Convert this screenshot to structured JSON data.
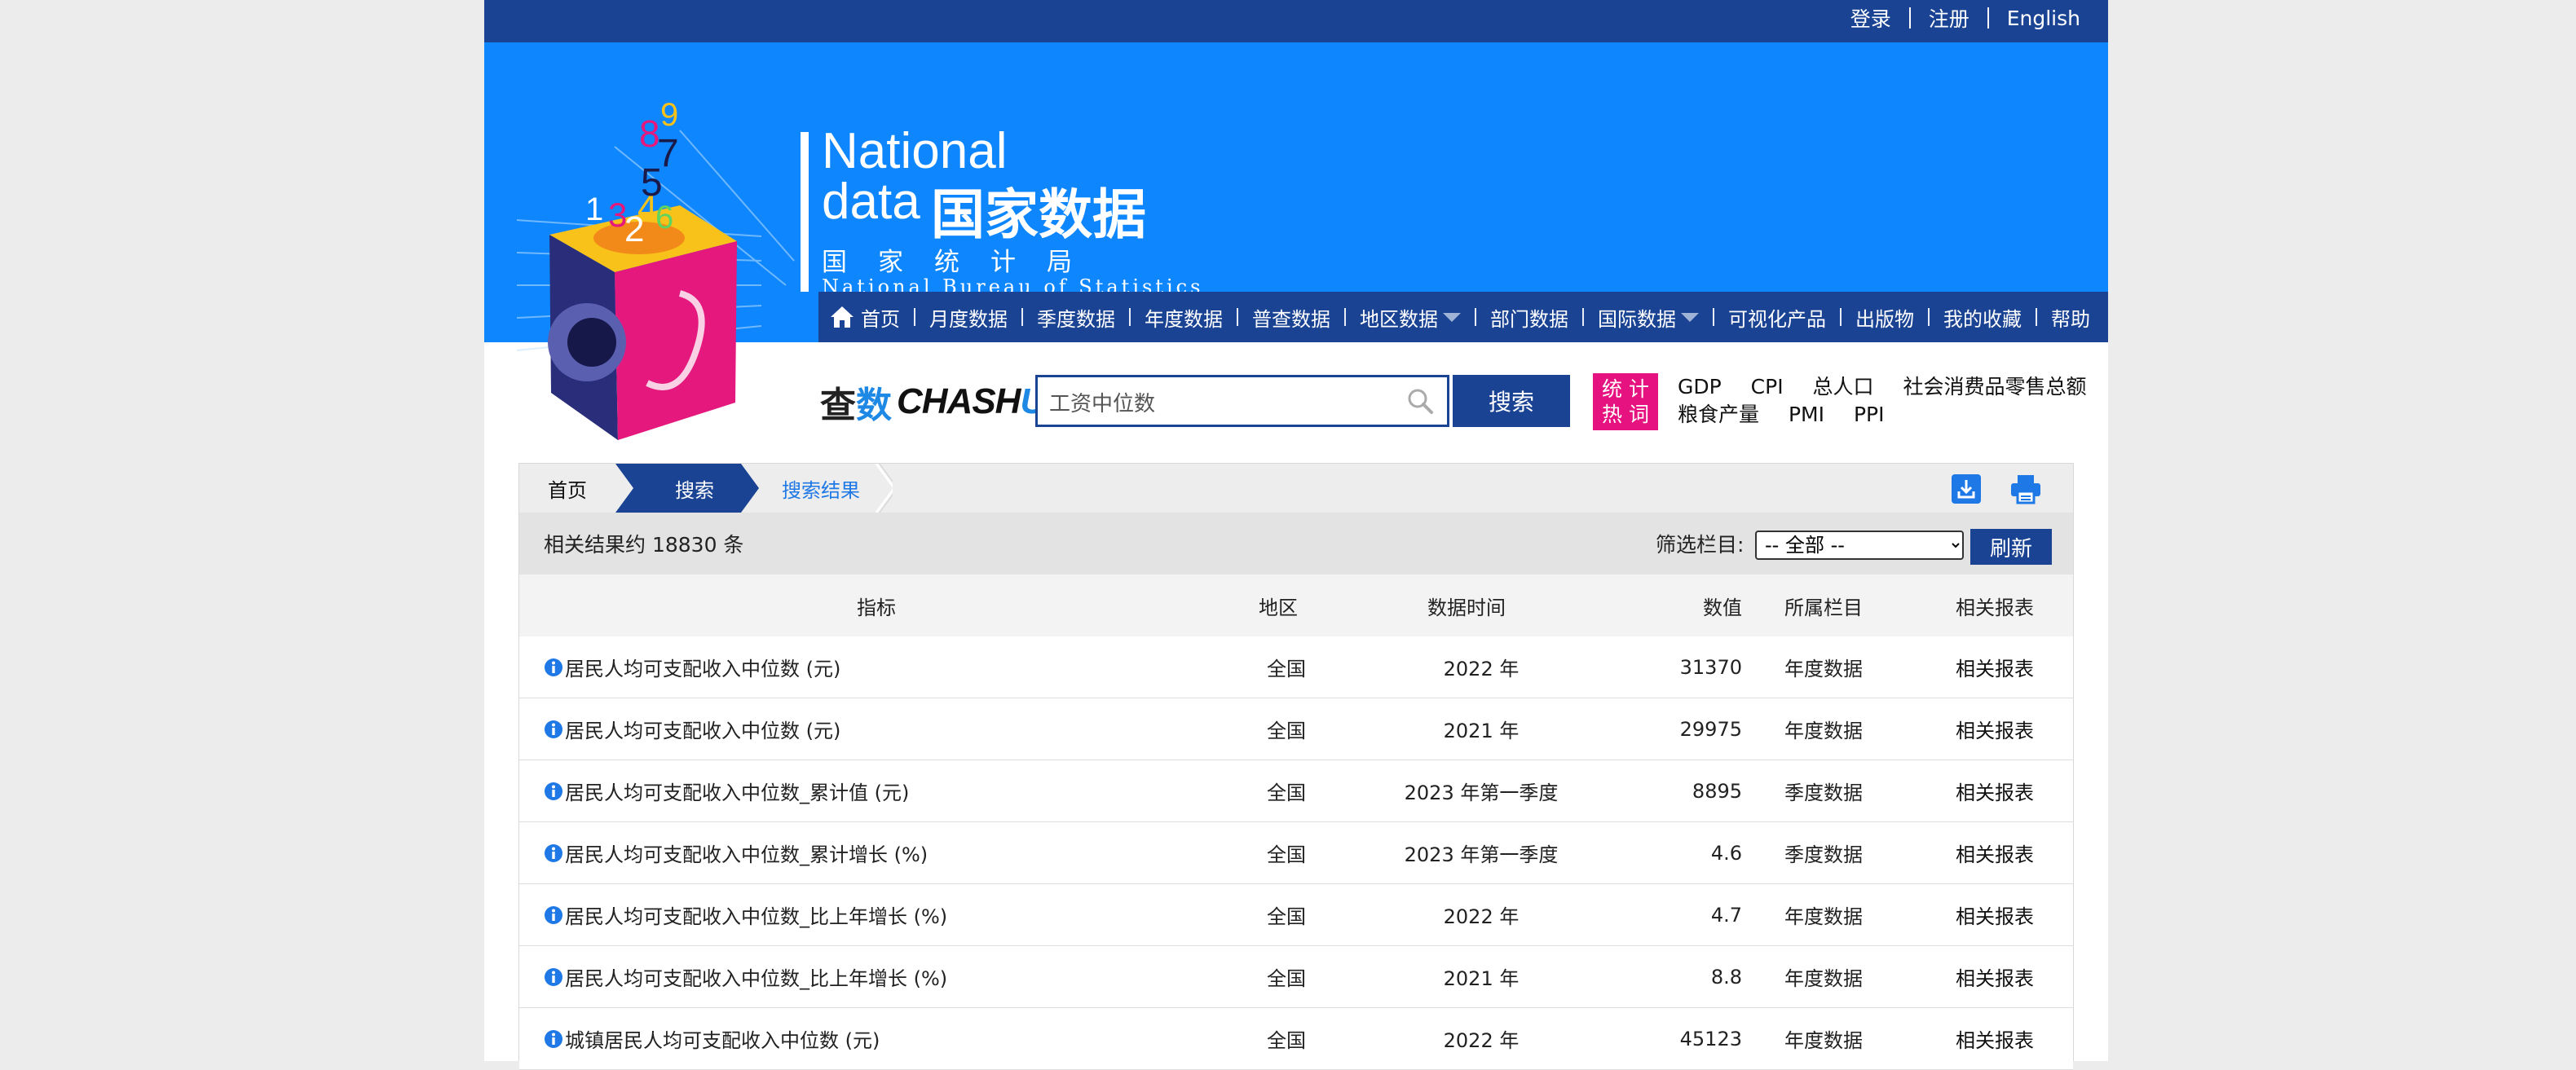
{
  "top_links": [
    "登录",
    "注册",
    "English"
  ],
  "brand": {
    "line1": "National",
    "line2_en": "data",
    "line2_cn": "国家数据",
    "bureau_cn": "国家统计局",
    "bureau_en": "National Bureau of Statistics"
  },
  "nav": [
    {
      "label": "首页",
      "icon": "home-icon"
    },
    {
      "label": "月度数据"
    },
    {
      "label": "季度数据"
    },
    {
      "label": "年度数据"
    },
    {
      "label": "普查数据"
    },
    {
      "label": "地区数据",
      "dropdown": true
    },
    {
      "label": "部门数据"
    },
    {
      "label": "国际数据",
      "dropdown": true
    },
    {
      "label": "可视化产品"
    },
    {
      "label": "出版物"
    },
    {
      "label": "我的收藏"
    },
    {
      "label": "帮助"
    }
  ],
  "search": {
    "logo_cn1": "查",
    "logo_cn2": "数",
    "logo_en_a": "CHASH",
    "logo_en_b": "U",
    "value": "工资中位数",
    "button_label": "搜索"
  },
  "hot": {
    "badge_line1": "统 计",
    "badge_line2": "热 词",
    "words_row1": [
      "GDP",
      "CPI",
      "总人口",
      "社会消费品零售总额"
    ],
    "words_row2": [
      "粮食产量",
      "PMI",
      "PPI"
    ]
  },
  "breadcrumb": {
    "home": "首页",
    "search": "搜索",
    "results": "搜索结果"
  },
  "results": {
    "count_text": "相关结果约 18830 条",
    "filter_label": "筛选栏目:",
    "filter_selected": "-- 全部 --",
    "refresh_label": "刷新"
  },
  "table": {
    "headers": {
      "indicator": "指标",
      "region": "地区",
      "time": "数据时间",
      "value": "数值",
      "column": "所属栏目",
      "report": "相关报表"
    },
    "rows": [
      {
        "indicator": "居民人均可支配收入中位数 (元)",
        "region": "全国",
        "time": "2022 年",
        "value": "31370",
        "column": "年度数据",
        "report": "相关报表"
      },
      {
        "indicator": "居民人均可支配收入中位数 (元)",
        "region": "全国",
        "time": "2021 年",
        "value": "29975",
        "column": "年度数据",
        "report": "相关报表"
      },
      {
        "indicator": "居民人均可支配收入中位数_累计值 (元)",
        "region": "全国",
        "time": "2023 年第一季度",
        "value": "8895",
        "column": "季度数据",
        "report": "相关报表"
      },
      {
        "indicator": "居民人均可支配收入中位数_累计增长 (%)",
        "region": "全国",
        "time": "2023 年第一季度",
        "value": "4.6",
        "column": "季度数据",
        "report": "相关报表"
      },
      {
        "indicator": "居民人均可支配收入中位数_比上年增长 (%)",
        "region": "全国",
        "time": "2022 年",
        "value": "4.7",
        "column": "年度数据",
        "report": "相关报表"
      },
      {
        "indicator": "居民人均可支配收入中位数_比上年增长 (%)",
        "region": "全国",
        "time": "2021 年",
        "value": "8.8",
        "column": "年度数据",
        "report": "相关报表"
      },
      {
        "indicator": "城镇居民人均可支配收入中位数 (元)",
        "region": "全国",
        "time": "2022 年",
        "value": "45123",
        "column": "年度数据",
        "report": "相关报表"
      }
    ]
  },
  "colors": {
    "dark_blue": "#1a4394",
    "banner_blue": "#0e86fe",
    "hot_pink": "#e5127f",
    "link_blue": "#1e78e6"
  }
}
